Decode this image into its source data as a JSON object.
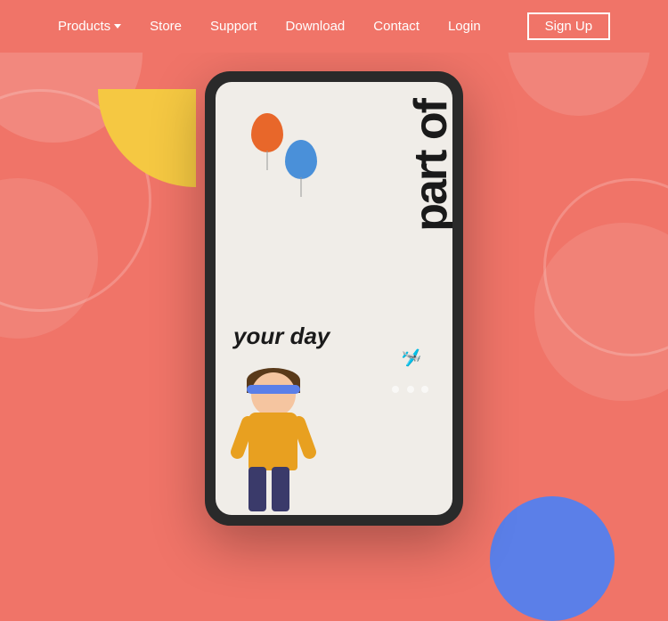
{
  "nav": {
    "items": [
      {
        "label": "Products",
        "hasDropdown": true
      },
      {
        "label": "Store",
        "hasDropdown": false
      },
      {
        "label": "Support",
        "hasDropdown": false
      },
      {
        "label": "Download",
        "hasDropdown": false
      },
      {
        "label": "Contact",
        "hasDropdown": false
      },
      {
        "label": "Login",
        "hasDropdown": false
      }
    ],
    "signup_label": "Sign Up"
  },
  "hero": {
    "vertical_text_line1": "part of",
    "your_day_text": "your day",
    "balloon_colors": [
      "orange",
      "blue"
    ],
    "airplane_emoji": "✈️"
  },
  "colors": {
    "background": "#F07468",
    "accent_blue": "#5B7FE8",
    "accent_yellow": "#F5C842"
  }
}
